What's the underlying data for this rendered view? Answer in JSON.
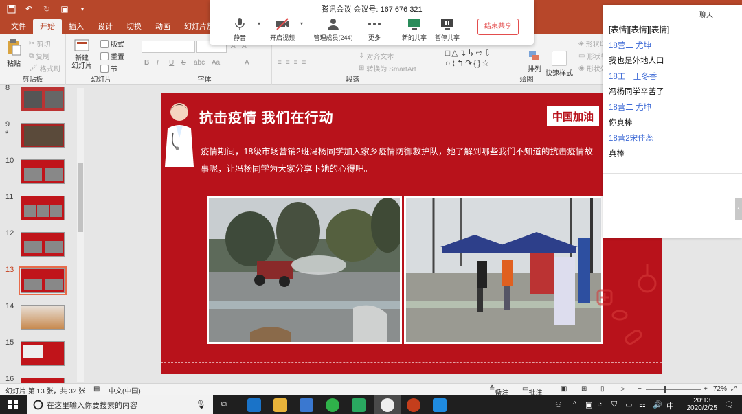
{
  "ppt": {
    "tabs": [
      "文件",
      "开始",
      "插入",
      "设计",
      "切换",
      "动画",
      "幻灯片放映"
    ],
    "active_tab": "开始",
    "ribbon": {
      "clipboard": {
        "label": "剪贴板",
        "paste": "粘贴",
        "cut": "剪切",
        "copy": "复制",
        "format_painter": "格式刷"
      },
      "slides": {
        "label": "幻灯片",
        "new_slide": "新建\n幻灯片",
        "layout": "版式",
        "reset": "重置",
        "section": "节"
      },
      "font": {
        "label": "字体",
        "bold": "B",
        "italic": "I",
        "underline": "U",
        "strike": "S",
        "spacing": "abc",
        "case": "Aa",
        "color": "A"
      },
      "paragraph": {
        "label": "段落",
        "align_text": "对齐文本",
        "convert_smartart": "转换为 SmartArt"
      },
      "drawing": {
        "label": "绘图",
        "arrange": "排列",
        "quick_styles": "快速样式",
        "shape_fill": "形状填充",
        "shape_outline": "形状轮廓",
        "shape_effects": "形状效果"
      }
    },
    "thumbnails": [
      {
        "num": "8"
      },
      {
        "num": "9",
        "star": "*"
      },
      {
        "num": "10"
      },
      {
        "num": "11"
      },
      {
        "num": "12"
      },
      {
        "num": "13"
      },
      {
        "num": "14"
      },
      {
        "num": "15"
      },
      {
        "num": "16"
      }
    ],
    "selected_slide": "13",
    "slide": {
      "title": "抗击疫情  我们在行动",
      "badge": "中国加油",
      "body": "疫情期间，18级市场营销2班冯杨同学加入家乡疫情防御救护队，她了解到哪些我们不知道的抗击疫情故事呢，让冯杨同学为大家分享下她的心得吧。"
    },
    "status": {
      "slide_info": "幻灯片 第 13 张，共 32 张",
      "language": "中文(中国)",
      "notes": "备注",
      "comments": "批注",
      "zoom": "72%"
    }
  },
  "meeting": {
    "title": "腾讯会议 会议号: 167 676 321",
    "buttons": {
      "mute": "静音",
      "video": "开启视频",
      "members": "管理成员(244)",
      "more": "更多",
      "new_share": "新的共享",
      "pause_share": "暂停共享"
    },
    "end_share": "结束共享"
  },
  "chat": {
    "title": "聊天",
    "messages": [
      {
        "name": "",
        "text": "[表情][表情][表情]"
      },
      {
        "name": "18营二 尤坤",
        "text": "我也是外地人口"
      },
      {
        "name": "18工一王冬香",
        "text": "冯杨同学辛苦了"
      },
      {
        "name": "18营二 尤坤",
        "text": "你真棒"
      },
      {
        "name": "18营2宋佳蕊",
        "text": "真棒"
      }
    ]
  },
  "taskbar": {
    "search_placeholder": "在这里输入你要搜索的内容",
    "time": "20:13",
    "date": "2020/2/25",
    "ime": "中"
  },
  "colors": {
    "ppt_accent": "#b7472a",
    "slide_bg": "#b8121b",
    "chat_name": "#3f6bd6",
    "end_share": "#e34d4d"
  }
}
